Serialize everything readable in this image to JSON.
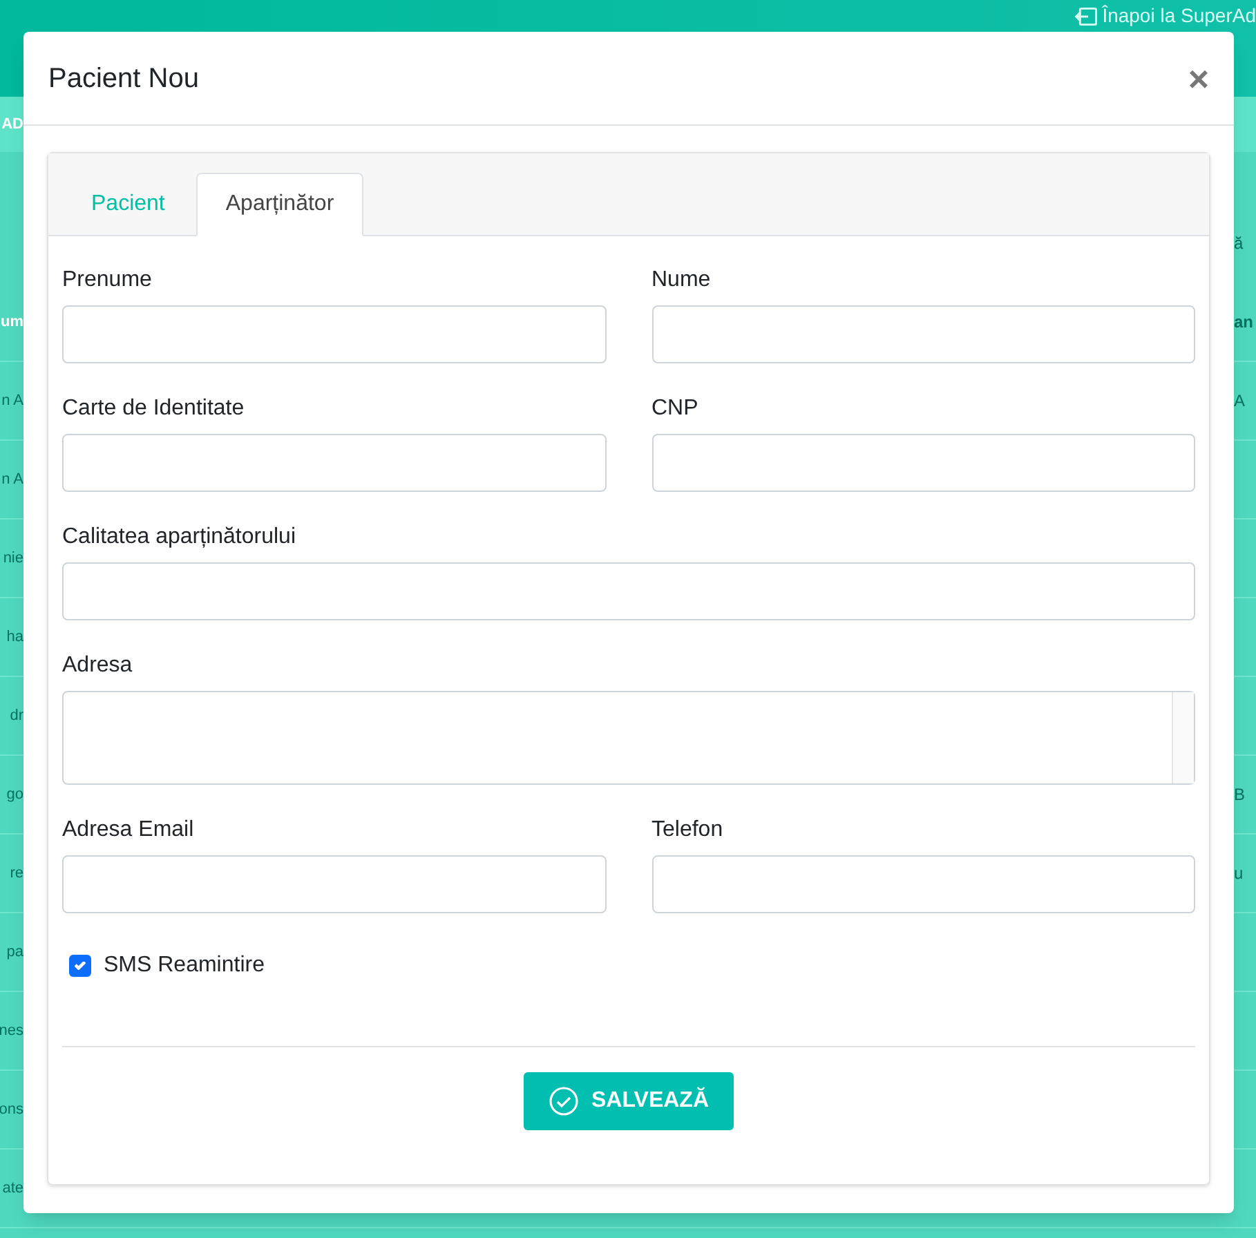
{
  "background": {
    "back_link": "Înapoi la SuperAd",
    "rows": [
      {
        "kind": "bar",
        "left": "AD"
      },
      {
        "kind": "toolbar",
        "right": "ă"
      },
      {
        "kind": "head",
        "left": "um",
        "right": "an"
      },
      {
        "kind": "row",
        "left": "n A",
        "right": "A"
      },
      {
        "kind": "row",
        "left": "n A"
      },
      {
        "kind": "row",
        "left": "nie"
      },
      {
        "kind": "row",
        "left": "ha"
      },
      {
        "kind": "row",
        "left": "dr"
      },
      {
        "kind": "row",
        "left": "go",
        "right": "B"
      },
      {
        "kind": "row",
        "left": "re",
        "right": "u"
      },
      {
        "kind": "row",
        "left": "pa"
      },
      {
        "kind": "row",
        "left": "nes"
      },
      {
        "kind": "row",
        "left": "ons"
      },
      {
        "kind": "row",
        "left": "ate"
      }
    ]
  },
  "modal": {
    "title": "Pacient Nou",
    "close": "×",
    "tabs": [
      {
        "label": "Pacient",
        "selected": false
      },
      {
        "label": "Aparținător",
        "selected": true
      }
    ],
    "fields": [
      {
        "kind": "half",
        "label": "Prenume"
      },
      {
        "kind": "half",
        "label": "Nume"
      },
      {
        "kind": "half",
        "label": "Carte de Identitate"
      },
      {
        "kind": "half",
        "label": "CNP"
      },
      {
        "kind": "full",
        "label": "Calitatea aparținătorului"
      },
      {
        "kind": "textarea",
        "label": "Adresa"
      },
      {
        "kind": "half",
        "label": "Adresa Email"
      },
      {
        "kind": "half",
        "label": "Telefon"
      }
    ],
    "sms": {
      "label": "SMS Reamintire",
      "checked": true
    },
    "save_button": "SALVEAZĂ"
  }
}
